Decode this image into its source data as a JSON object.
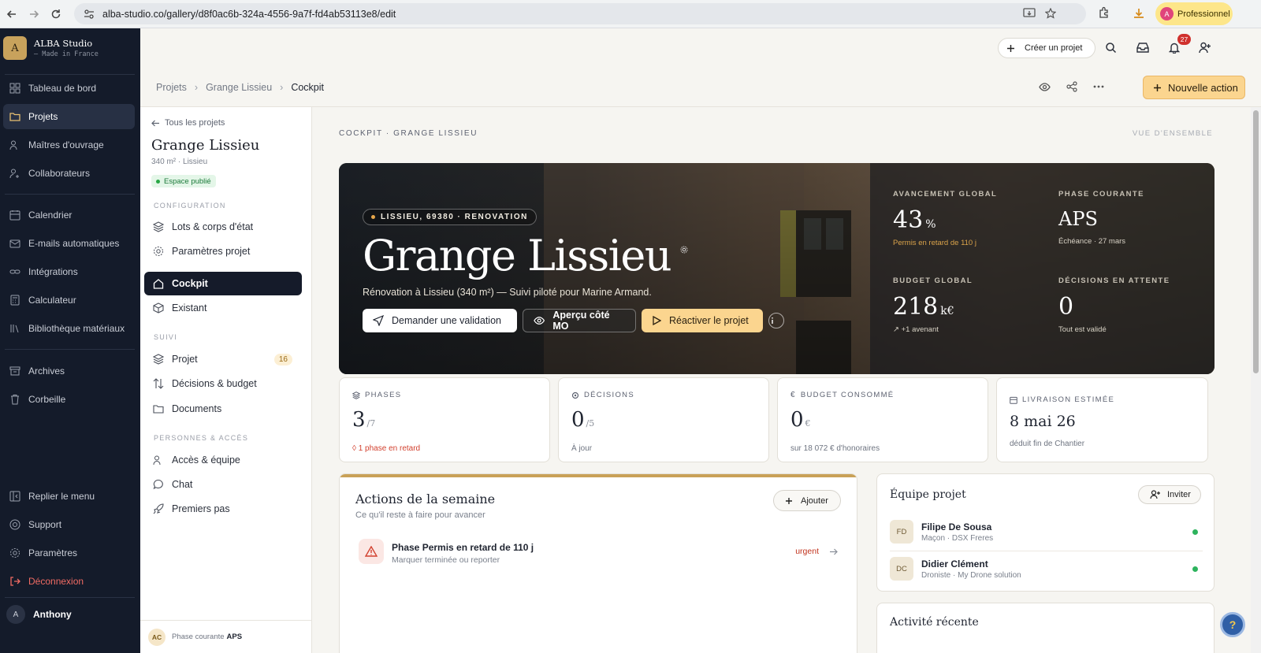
{
  "browser": {
    "url": "alba-studio.co/gallery/d8f0ac6b-324a-4556-9a7f-fd4ab53113e8/edit",
    "profile_label": "Professionnel",
    "profile_initial": "A"
  },
  "sidebar": {
    "brand_name": "ALBA Studio",
    "brand_tagline": "— Made in France",
    "logo_letter": "A",
    "items": [
      {
        "label": "Tableau de bord",
        "icon": "dashboard-icon"
      },
      {
        "label": "Projets",
        "icon": "folder-icon",
        "active": true
      },
      {
        "label": "Maîtres d'ouvrage",
        "icon": "users-icon"
      },
      {
        "label": "Collaborateurs",
        "icon": "user-key-icon"
      },
      {
        "label": "Calendrier",
        "icon": "calendar-icon"
      },
      {
        "label": "E-mails automatiques",
        "icon": "mail-icon"
      },
      {
        "label": "Intégrations",
        "icon": "link-icon"
      },
      {
        "label": "Calculateur",
        "icon": "calculator-icon"
      },
      {
        "label": "Bibliothèque matériaux",
        "icon": "library-icon"
      },
      {
        "label": "Archives",
        "icon": "archive-icon"
      },
      {
        "label": "Corbeille",
        "icon": "trash-icon"
      }
    ],
    "bottom": [
      {
        "label": "Replier le menu",
        "icon": "collapse-icon"
      },
      {
        "label": "Support",
        "icon": "support-icon"
      },
      {
        "label": "Paramètres",
        "icon": "settings-icon"
      },
      {
        "label": "Déconnexion",
        "icon": "logout-icon"
      }
    ],
    "user": {
      "initial": "A",
      "name": "Anthony"
    }
  },
  "header": {
    "create_label": "Créer un projet",
    "notif_count": "27",
    "breadcrumb": [
      "Projets",
      "Grange Lissieu",
      "Cockpit"
    ],
    "new_action_label": "Nouvelle action"
  },
  "project_panel": {
    "back_label": "Tous les projets",
    "title": "Grange Lissieu",
    "subtitle": "340 m² · Lissieu",
    "badge": "Espace publié",
    "sections": {
      "config": "CONFIGURATION",
      "suivi": "SUIVI",
      "people": "PERSONNES & ACCÈS"
    },
    "config_items": [
      "Lots & corps d'état",
      "Paramètres projet",
      "Cockpit",
      "Existant"
    ],
    "suivi_items": [
      "Projet",
      "Décisions & budget",
      "Documents"
    ],
    "projet_count": "16",
    "people_items": [
      "Accès & équipe",
      "Chat",
      "Premiers pas"
    ],
    "footer": {
      "initials": "AC",
      "label": "Phase courante",
      "phase": "APS"
    }
  },
  "main": {
    "kicker": "COCKPIT · GRANGE LISSIEU",
    "view_label": "VUE D'ENSEMBLE",
    "hero": {
      "pill": "LISSIEU, 69380 · RENOVATION",
      "title": "Grange Lissieu",
      "subtitle": "Rénovation à Lissieu (340 m²) — Suivi piloté pour Marine Armand.",
      "btn_validation": "Demander une validation",
      "btn_apercu": "Aperçu côté MO",
      "btn_reactivate": "Réactiver le projet",
      "stats": {
        "progress_label": "AVANCEMENT GLOBAL",
        "progress_value": "43",
        "progress_unit": "%",
        "progress_note": "Permis en retard de 110 j",
        "phase_label": "PHASE COURANTE",
        "phase_value": "APS",
        "phase_note": "Échéance · 27 mars",
        "budget_label": "BUDGET GLOBAL",
        "budget_value": "218",
        "budget_unit": "k€",
        "budget_note": "↗ +1 avenant",
        "decisions_label": "DÉCISIONS EN ATTENTE",
        "decisions_value": "0",
        "decisions_note": "Tout est validé"
      }
    },
    "kpis": [
      {
        "label": "PHASES",
        "value": "3",
        "unit": "/7",
        "note": "◊ 1 phase en retard"
      },
      {
        "label": "DÉCISIONS",
        "value": "0",
        "unit": "/5",
        "note": "À jour"
      },
      {
        "label": "BUDGET CONSOMMÉ",
        "value": "0",
        "unit": "€",
        "note": "sur 18 072 € d'honoraires"
      },
      {
        "label": "LIVRAISON ESTIMÉE",
        "value": "8 mai 26",
        "unit": "",
        "note": "déduit fin de Chantier"
      }
    ],
    "actions": {
      "title": "Actions de la semaine",
      "subtitle": "Ce qu'il reste à faire pour avancer",
      "add_label": "Ajouter",
      "items": [
        {
          "title": "Phase Permis en retard de 110 j",
          "subtitle": "Marquer terminée ou reporter",
          "tag": "urgent"
        }
      ]
    },
    "team": {
      "title": "Équipe projet",
      "invite_label": "Inviter",
      "members": [
        {
          "initials": "FD",
          "name": "Filipe De Sousa",
          "role": "Maçon · DSX Freres"
        },
        {
          "initials": "DC",
          "name": "Didier Clément",
          "role": "Droniste · My Drone solution"
        }
      ]
    },
    "activity": {
      "title": "Activité récente"
    }
  }
}
